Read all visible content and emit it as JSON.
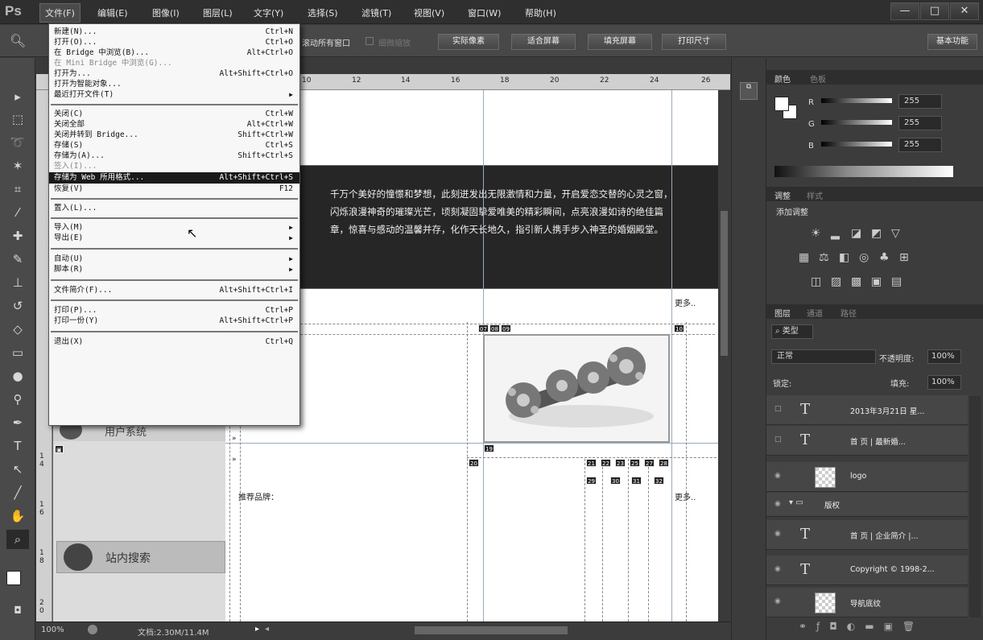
{
  "app": {
    "logo": "Ps"
  },
  "menubar": {
    "items": [
      "文件(F)",
      "编辑(E)",
      "图像(I)",
      "图层(L)",
      "文字(Y)",
      "选择(S)",
      "滤镜(T)",
      "视图(V)",
      "窗口(W)",
      "帮助(H)"
    ],
    "window_buttons": [
      "—",
      "□",
      "✕"
    ]
  },
  "optionsbar": {
    "scroll_all": "滚动所有窗口",
    "fine_zoom": "细微缩放",
    "buttons": [
      "实际像素",
      "适合屏幕",
      "填充屏幕",
      "打印尺寸"
    ],
    "workspace": "基本功能"
  },
  "file_menu": {
    "items": [
      {
        "label": "新建(N)...",
        "shortcut": "Ctrl+N"
      },
      {
        "label": "打开(O)...",
        "shortcut": "Ctrl+O"
      },
      {
        "label": "在 Bridge 中浏览(B)...",
        "shortcut": "Alt+Ctrl+O"
      },
      {
        "label": "在 Mini Bridge 中浏览(G)...",
        "shortcut": "",
        "disabled": true
      },
      {
        "label": "打开为...",
        "shortcut": "Alt+Shift+Ctrl+O"
      },
      {
        "label": "打开为智能对象...",
        "shortcut": ""
      },
      {
        "label": "最近打开文件(T)",
        "shortcut": "",
        "submenu": true
      },
      {
        "label": "关闭(C)",
        "shortcut": "Ctrl+W"
      },
      {
        "label": "关闭全部",
        "shortcut": "Alt+Ctrl+W"
      },
      {
        "label": "关闭并转到 Bridge...",
        "shortcut": "Shift+Ctrl+W"
      },
      {
        "label": "存储(S)",
        "shortcut": "Ctrl+S"
      },
      {
        "label": "存储为(A)...",
        "shortcut": "Shift+Ctrl+S"
      },
      {
        "label": "签入(I)...",
        "shortcut": "",
        "disabled": true
      },
      {
        "label": "存储为 Web 所用格式...",
        "shortcut": "Alt+Shift+Ctrl+S",
        "highlight": true
      },
      {
        "label": "恢复(V)",
        "shortcut": "F12"
      },
      {
        "label": "置入(L)...",
        "shortcut": ""
      },
      {
        "label": "导入(M)",
        "shortcut": "",
        "submenu": true
      },
      {
        "label": "导出(E)",
        "shortcut": "",
        "submenu": true
      },
      {
        "label": "自动(U)",
        "shortcut": "",
        "submenu": true
      },
      {
        "label": "脚本(R)",
        "shortcut": "",
        "submenu": true
      },
      {
        "label": "文件简介(F)...",
        "shortcut": "Alt+Shift+Ctrl+I"
      },
      {
        "label": "打印(P)...",
        "shortcut": "Ctrl+P"
      },
      {
        "label": "打印一份(Y)",
        "shortcut": "Alt+Shift+Ctrl+P"
      },
      {
        "label": "退出(X)",
        "shortcut": "Ctrl+Q"
      }
    ]
  },
  "ruler": {
    "top": [
      "10",
      "12",
      "14",
      "16",
      "18",
      "20",
      "22",
      "24",
      "26"
    ],
    "left": [
      "1",
      "4",
      "1",
      "6",
      "1",
      "8",
      "2",
      "0"
    ]
  },
  "document": {
    "banner_text": "千万个美好的憧憬和梦想，此刻迸发出无限激情和力量，开启爱恋交替的心灵之窗，闪烁浪漫神奇的璀璨光芒，顷刻凝固挚爱唯美的精彩瞬间，点亮浪漫如诗的绝佳篇章，惊喜与感动的温馨并存，化作天长地久，指引新人携手步入神圣的婚姻殿堂。",
    "more1": "更多..",
    "more2": "更多..",
    "brands": "推荐品牌：",
    "search": "站内搜索",
    "user_system": "用户系统",
    "slices": [
      "07",
      "08",
      "09",
      "10",
      "16",
      "19",
      "20",
      "21",
      "22",
      "23",
      "25",
      "27",
      "28",
      "29",
      "30",
      "31",
      "32"
    ]
  },
  "statusbar": {
    "zoom": "100%",
    "doc": "文档:2.30M/11.4M"
  },
  "color_panel": {
    "tabs": [
      "颜色",
      "色板"
    ],
    "channels": [
      {
        "name": "R",
        "value": "255"
      },
      {
        "name": "G",
        "value": "255"
      },
      {
        "name": "B",
        "value": "255"
      }
    ]
  },
  "adjust_panel": {
    "tabs": [
      "调整",
      "样式"
    ],
    "title": "添加调整"
  },
  "layers_panel": {
    "tabs": [
      "图层",
      "通道",
      "路径"
    ],
    "filter": "类型",
    "blend": "正常",
    "opacity_label": "不透明度:",
    "opacity": "100%",
    "lock_label": "锁定:",
    "fill_label": "填充:",
    "fill": "100%",
    "layers": [
      {
        "type": "T",
        "name": "2013年3月21日 星..."
      },
      {
        "type": "T",
        "name": "首 页 | 最新婚..."
      },
      {
        "type": "img",
        "name": "logo"
      },
      {
        "type": "group",
        "name": "版权"
      },
      {
        "type": "T",
        "name": "首 页 | 企业简介 |..."
      },
      {
        "type": "T",
        "name": "Copyright © 1998-2..."
      },
      {
        "type": "img",
        "name": "导航底纹"
      }
    ]
  }
}
